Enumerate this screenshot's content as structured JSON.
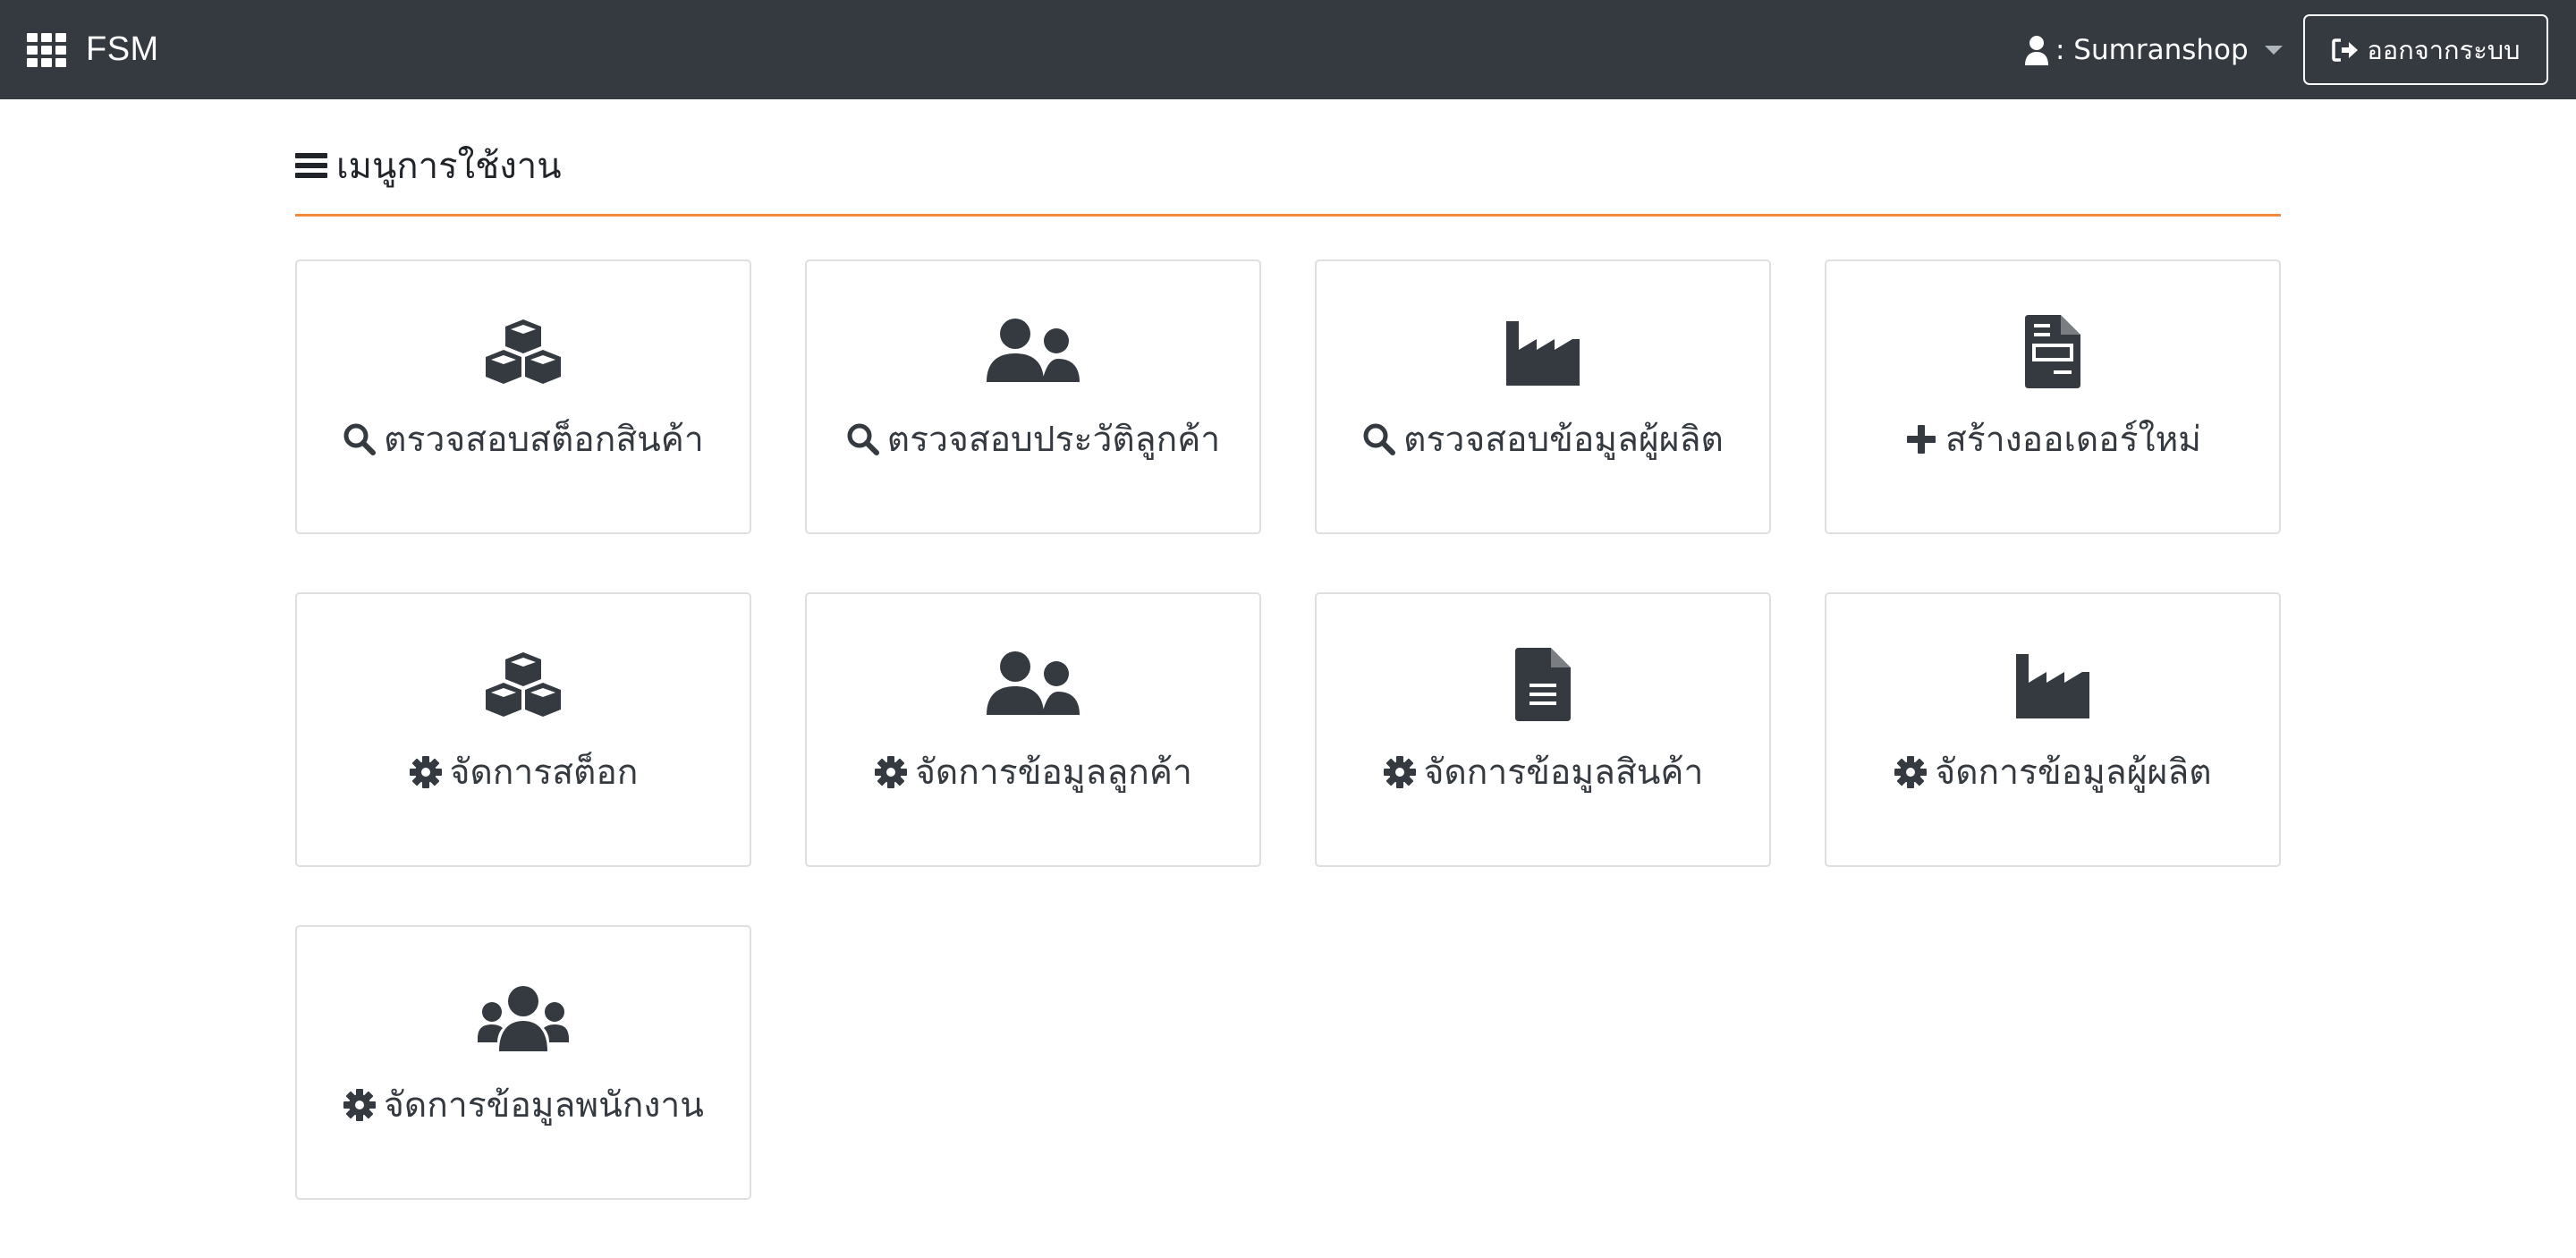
{
  "navbar": {
    "brand": "FSM",
    "brand_icon": "grid-icon",
    "user_label": ": Sumranshop",
    "user_icon": "user-icon",
    "logout_label": "ออกจากระบบ",
    "logout_icon": "sign-out-icon",
    "background": "#343a40"
  },
  "page": {
    "title": "เมนูการใช้งาน",
    "title_icon": "bars-icon",
    "accent": "#f48a3c"
  },
  "menu": [
    {
      "icon": "cubes-icon",
      "action_icon": "search-icon",
      "label": "ตรวจสอบสต็อกสินค้า"
    },
    {
      "icon": "user-friends-icon",
      "action_icon": "search-icon",
      "label": "ตรวจสอบประวัติลูกค้า"
    },
    {
      "icon": "industry-icon",
      "action_icon": "search-icon",
      "label": "ตรวจสอบข้อมูลผู้ผลิต"
    },
    {
      "icon": "file-invoice-icon",
      "action_icon": "plus-icon",
      "label": "สร้างออเดอร์ใหม่"
    },
    {
      "icon": "cubes-icon",
      "action_icon": "cog-icon",
      "label": "จัดการสต็อก"
    },
    {
      "icon": "user-friends-icon",
      "action_icon": "cog-icon",
      "label": "จัดการข้อมูลลูกค้า"
    },
    {
      "icon": "file-alt-icon",
      "action_icon": "cog-icon",
      "label": "จัดการข้อมูลสินค้า"
    },
    {
      "icon": "industry-icon",
      "action_icon": "cog-icon",
      "label": "จัดการข้อมูลผู้ผลิต"
    },
    {
      "icon": "users-icon",
      "action_icon": "cog-icon",
      "label": "จัดการข้อมูลพนักงาน"
    }
  ]
}
